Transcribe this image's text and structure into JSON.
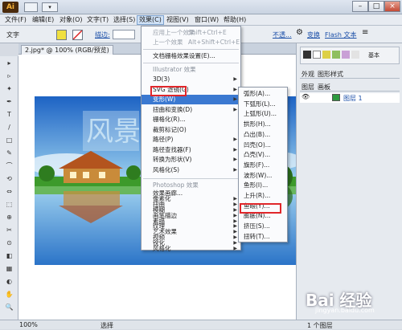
{
  "app": {
    "logo": "Ai"
  },
  "menubar": [
    "文件(F)",
    "编辑(E)",
    "对象(O)",
    "文字(T)",
    "选择(S)",
    "效果(C)",
    "视图(V)",
    "窗口(W)",
    "帮助(H)"
  ],
  "control": {
    "text_label": "文字",
    "stroke_label": "描边:",
    "opacity_label": "不透...",
    "transform_label": "变换",
    "flash_label": "Flash 文本"
  },
  "doc_tab": "2.jpg* @ 100% (RGB/预览)",
  "effect_menu": {
    "apply_last": "应用上一个效果",
    "apply_last_sc": "Shift+Ctrl+E",
    "last": "上一个效果",
    "last_sc": "Alt+Shift+Ctrl+E",
    "raster": "文档栅格效果设置(E)...",
    "illustrator_header": "Illustrator 效果",
    "illustrator_items": [
      "3D(3)",
      "SVG 滤镜(G)",
      "变形(W)",
      "扭曲和变换(D)",
      "栅格化(R)...",
      "裁剪标记(O)",
      "路径(P)",
      "路径查找器(F)",
      "转换为形状(V)",
      "风格化(S)"
    ],
    "photoshop_header": "Photoshop 效果",
    "photoshop_items": [
      "效果画廊...",
      "像素化",
      "扭曲",
      "模糊",
      "画笔描边",
      "素描",
      "纹理",
      "艺术效果",
      "视频",
      "锐化",
      "风格化"
    ]
  },
  "warp_menu": [
    "弧形(A)...",
    "下弧形(L)...",
    "上弧形(U)...",
    "拱形(H)...",
    "凸出(B)...",
    "凹壳(O)...",
    "凸壳(V)...",
    "旗形(F)...",
    "波形(W)...",
    "鱼形(I)...",
    "上升(R)...",
    "鱼眼(Y)...",
    "膨胀(N)...",
    "挤压(S)...",
    "扭转(T)..."
  ],
  "panel": {
    "tab_appearance": "外观",
    "tab_styles": "图形样式",
    "tab_layers": "图层",
    "tab_artboards": "画板",
    "layer_name": "图层 1",
    "footer": "1 个图层",
    "swatch_label": "基本"
  },
  "status": {
    "zoom": "100%",
    "tool": "选择"
  },
  "watermark": {
    "main": "Bai 经验",
    "sub": "jingyan.baidu.com"
  },
  "artwork_text": "风景",
  "tools": [
    "▸",
    "▹",
    "✦",
    "✒",
    "T",
    "/",
    "□",
    "✎",
    "⌒",
    "⟲",
    "⇔",
    "⬚",
    "⊕",
    "✂",
    "⊙",
    "◧",
    "▦",
    "◐",
    "✋",
    "🔍"
  ],
  "colors": {
    "accent": "#3b79d1",
    "highlight_box": "#e0262a"
  }
}
